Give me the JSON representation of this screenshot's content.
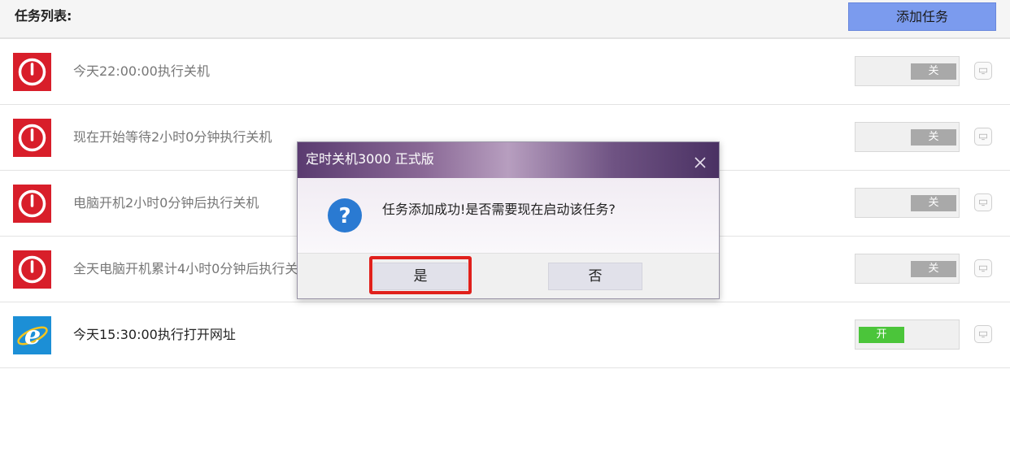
{
  "header": {
    "title": "任务列表:",
    "add_button": "添加任务"
  },
  "tasks": [
    {
      "text": "今天22:00:00执行关机",
      "icon": "power-icon",
      "toggle": "关",
      "enabled": false
    },
    {
      "text": "现在开始等待2小时0分钟执行关机",
      "icon": "power-icon",
      "toggle": "关",
      "enabled": false
    },
    {
      "text": "电脑开机2小时0分钟后执行关机",
      "icon": "power-icon",
      "toggle": "关",
      "enabled": false
    },
    {
      "text": "全天电脑开机累计4小时0分钟后执行关机",
      "icon": "power-icon",
      "toggle": "关",
      "enabled": false
    },
    {
      "text": "今天15:30:00执行打开网址",
      "icon": "ie-browser-icon",
      "toggle": "开",
      "enabled": true
    }
  ],
  "dialog": {
    "title": "定时关机3000 正式版",
    "icon": "question-icon",
    "message": "任务添加成功!是否需要现在启动该任务?",
    "yes_label": "是",
    "no_label": "否"
  },
  "colors": {
    "power_red": "#d81e2a",
    "toggle_on": "#4bc53a",
    "toggle_off": "#a9a9a9",
    "accent_button": "#7b9bee",
    "ie_blue": "#1c8fd6",
    "highlight": "#e0201c"
  }
}
